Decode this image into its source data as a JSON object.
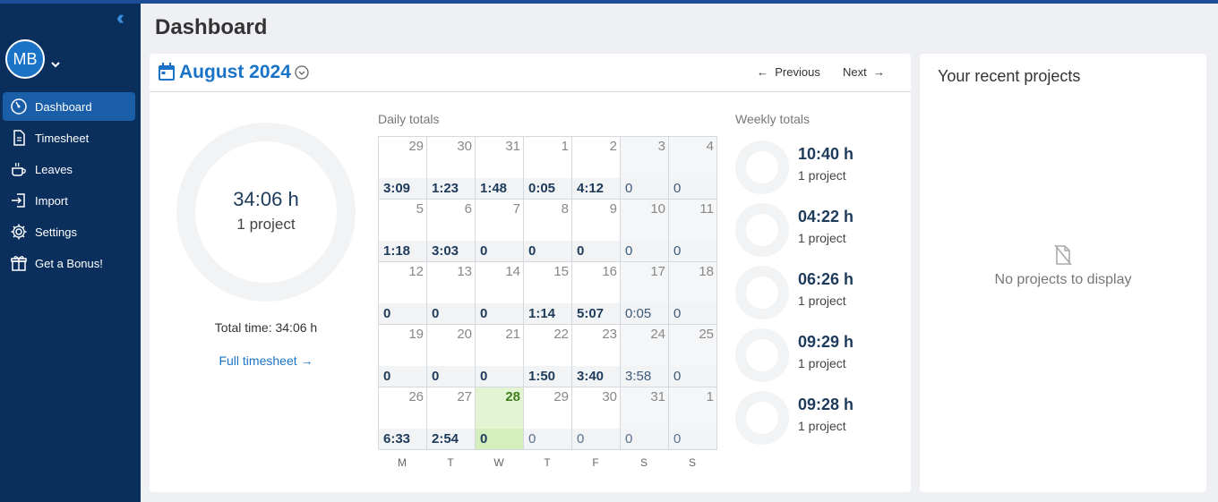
{
  "sidebar": {
    "avatar_initials": "MB",
    "items": [
      {
        "label": "Dashboard",
        "icon": "dashboard-gauge-icon",
        "active": true
      },
      {
        "label": "Timesheet",
        "icon": "document-icon"
      },
      {
        "label": "Leaves",
        "icon": "coffee-cup-icon"
      },
      {
        "label": "Import",
        "icon": "import-icon"
      },
      {
        "label": "Settings",
        "icon": "gear-icon"
      },
      {
        "label": "Get a Bonus!",
        "icon": "gift-icon"
      }
    ]
  },
  "page": {
    "title": "Dashboard"
  },
  "calendar": {
    "month": "August 2024",
    "prev_label": "Previous",
    "next_label": "Next",
    "summary": {
      "hours": "34:06 h",
      "projects": "1 project",
      "total_time": "Total time: 34:06 h",
      "full_timesheet": "Full timesheet →"
    },
    "daily_title": "Daily totals",
    "weekly_title": "Weekly totals",
    "weekdays": [
      "M",
      "T",
      "W",
      "T",
      "F",
      "S",
      "S"
    ],
    "weeks": [
      [
        {
          "d": "29",
          "t": "3:09"
        },
        {
          "d": "30",
          "t": "1:23"
        },
        {
          "d": "31",
          "t": "1:48"
        },
        {
          "d": "1",
          "t": "0:05"
        },
        {
          "d": "2",
          "t": "4:12"
        },
        {
          "d": "3",
          "t": "0"
        },
        {
          "d": "4",
          "t": "0"
        }
      ],
      [
        {
          "d": "5",
          "t": "1:18"
        },
        {
          "d": "6",
          "t": "3:03"
        },
        {
          "d": "7",
          "t": "0"
        },
        {
          "d": "8",
          "t": "0"
        },
        {
          "d": "9",
          "t": "0"
        },
        {
          "d": "10",
          "t": "0"
        },
        {
          "d": "11",
          "t": "0"
        }
      ],
      [
        {
          "d": "12",
          "t": "0"
        },
        {
          "d": "13",
          "t": "0"
        },
        {
          "d": "14",
          "t": "0"
        },
        {
          "d": "15",
          "t": "1:14"
        },
        {
          "d": "16",
          "t": "5:07"
        },
        {
          "d": "17",
          "t": "0:05"
        },
        {
          "d": "18",
          "t": "0"
        }
      ],
      [
        {
          "d": "19",
          "t": "0"
        },
        {
          "d": "20",
          "t": "0"
        },
        {
          "d": "21",
          "t": "0"
        },
        {
          "d": "22",
          "t": "1:50"
        },
        {
          "d": "23",
          "t": "3:40"
        },
        {
          "d": "24",
          "t": "3:58"
        },
        {
          "d": "25",
          "t": "0"
        }
      ],
      [
        {
          "d": "26",
          "t": "6:33"
        },
        {
          "d": "27",
          "t": "2:54"
        },
        {
          "d": "28",
          "t": "0",
          "today": true
        },
        {
          "d": "29",
          "t": "0",
          "faded": true
        },
        {
          "d": "30",
          "t": "0",
          "faded": true
        },
        {
          "d": "31",
          "t": "0",
          "faded": true
        },
        {
          "d": "1",
          "t": "0",
          "faded": true
        }
      ]
    ],
    "weekly": [
      {
        "hours": "10:40 h",
        "projects": "1 project"
      },
      {
        "hours": "04:22 h",
        "projects": "1 project"
      },
      {
        "hours": "06:26 h",
        "projects": "1 project"
      },
      {
        "hours": "09:29 h",
        "projects": "1 project"
      },
      {
        "hours": "09:28 h",
        "projects": "1 project"
      }
    ]
  },
  "projects": {
    "title": "Your recent projects",
    "empty_text": "No projects to display",
    "empty_icon": "no-document-icon"
  },
  "colors": {
    "accent": "#1a73c7",
    "sidebar_bg": "#0a2f5c",
    "today_bg": "#e3f4d2"
  }
}
